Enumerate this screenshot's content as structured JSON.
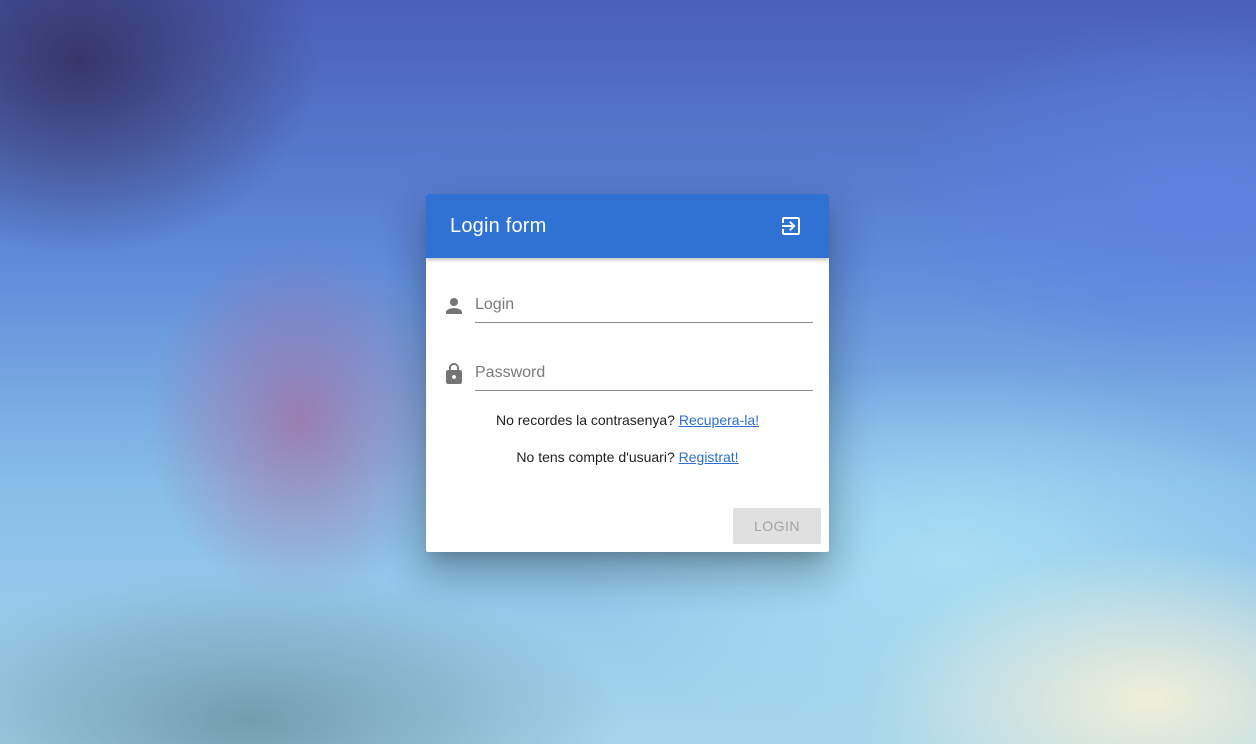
{
  "background": {
    "accent": "#3072d3"
  },
  "dialog": {
    "title": "Login form",
    "header_icon": "exit-to-app-icon",
    "header_color": "#3072d3"
  },
  "fields": {
    "login": {
      "icon": "person-icon",
      "placeholder": "Login",
      "value": ""
    },
    "password": {
      "icon": "lock-icon",
      "placeholder": "Password",
      "value": ""
    }
  },
  "recover": {
    "text": "No recordes la contrasenya?",
    "link": "Recupera-la!"
  },
  "register": {
    "text": "No tens compte d'usuari?",
    "link": "Registrat!"
  },
  "actions": {
    "login_label": "LOGIN",
    "login_disabled": true
  }
}
